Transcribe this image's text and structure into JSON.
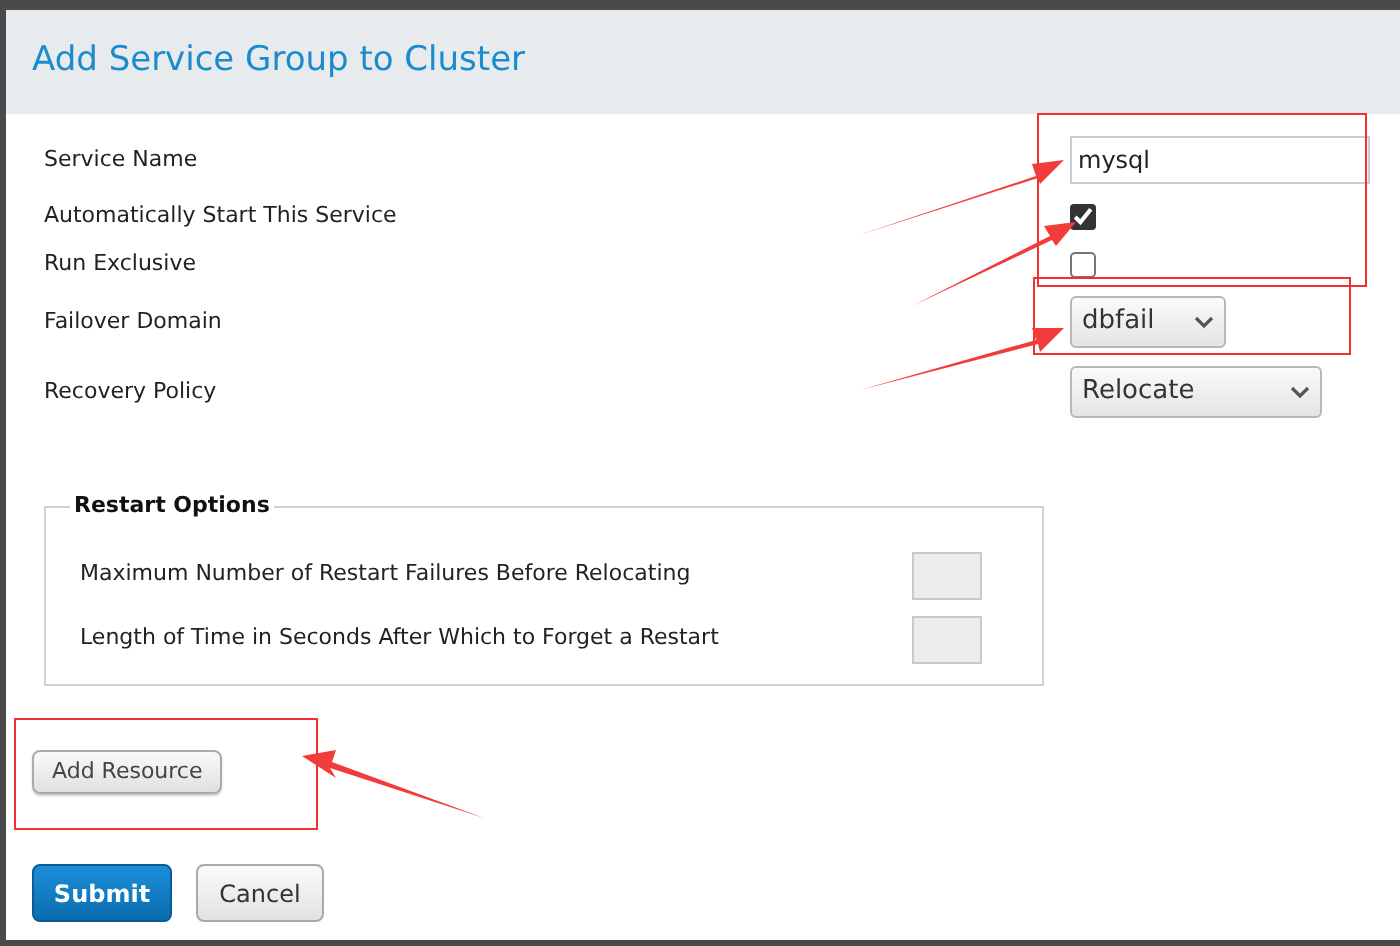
{
  "dialog": {
    "title": "Add Service Group to Cluster"
  },
  "fields": [
    {
      "kind": "text",
      "label": "Service Name",
      "value": "mysql"
    },
    {
      "kind": "checkbox",
      "label": "Automatically Start This Service",
      "checked": true
    },
    {
      "kind": "checkbox",
      "label": "Run Exclusive",
      "checked": false
    },
    {
      "kind": "select",
      "label": "Failover Domain",
      "value": "dbfail"
    },
    {
      "kind": "select",
      "label": "Recovery Policy",
      "value": "Relocate"
    }
  ],
  "restart_options": {
    "legend": "Restart Options",
    "fields": [
      {
        "label": "Maximum Number of Restart Failures Before Relocating"
      },
      {
        "label": "Length of Time in Seconds After Which to Forget a Restart"
      }
    ]
  },
  "add_resource_button": "Add Resource",
  "buttons": [
    {
      "kind": "primary",
      "label": "Submit"
    },
    {
      "kind": "secondary",
      "label": "Cancel"
    }
  ]
}
